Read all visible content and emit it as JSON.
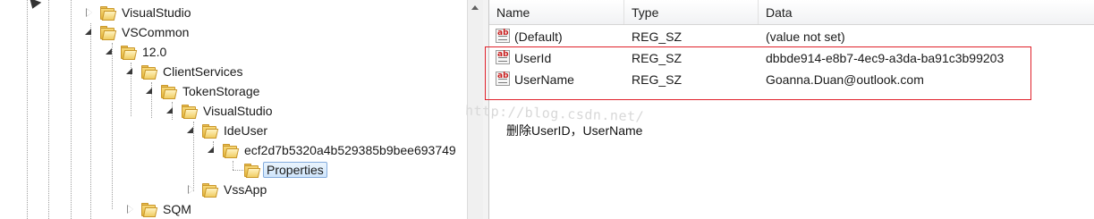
{
  "tree": {
    "nodes": [
      {
        "label": "VisualStudio",
        "state": "collapsed"
      },
      {
        "label": "VSCommon",
        "state": "expanded"
      },
      {
        "label": "12.0",
        "state": "expanded"
      },
      {
        "label": "ClientServices",
        "state": "expanded"
      },
      {
        "label": "TokenStorage",
        "state": "expanded"
      },
      {
        "label": "VisualStudio",
        "state": "expanded"
      },
      {
        "label": "IdeUser",
        "state": "expanded"
      },
      {
        "label": "ecf2d7b5320a4b529385b9bee693749",
        "state": "expanded"
      },
      {
        "label": "Properties",
        "state": "leaf",
        "selected": true
      },
      {
        "label": "VssApp",
        "state": "collapsed"
      },
      {
        "label": "SQM",
        "state": "collapsed"
      }
    ]
  },
  "list": {
    "columns": [
      "Name",
      "Type",
      "Data"
    ],
    "rows": [
      {
        "name": "(Default)",
        "type": "REG_SZ",
        "data": "(value not set)",
        "icon": "string-value-icon"
      },
      {
        "name": "UserId",
        "type": "REG_SZ",
        "data": "dbbde914-e8b7-4ec9-a3da-ba91c3b99203",
        "icon": "string-value-icon"
      },
      {
        "name": "UserName",
        "type": "REG_SZ",
        "data": "Goanna.Duan@outlook.com",
        "icon": "string-value-icon"
      }
    ]
  },
  "watermark": "http://blog.csdn.net/",
  "note": "删除UserID，UserName",
  "colors": {
    "highlight_box": "#e0202a",
    "selection": "#cfe5fb"
  }
}
